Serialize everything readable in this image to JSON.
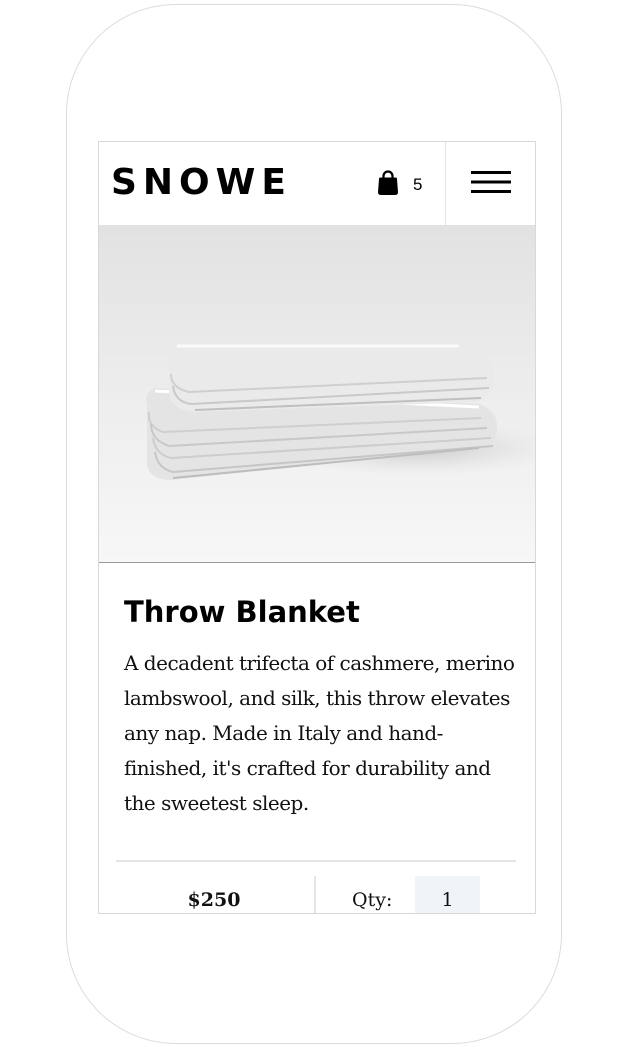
{
  "brand": {
    "logo_text": "SNOWE"
  },
  "header": {
    "cart_icon": "shopping-bag-icon",
    "cart_count": "5",
    "menu_icon": "hamburger-menu-icon"
  },
  "product": {
    "image_alt": "Stacked folded throw blankets",
    "title": "Throw Blanket",
    "description": "A decadent trifecta of cashmere, merino lambswool, and silk, this throw elevates any nap. Made in Italy and hand-finished, it's crafted for durability and the sweetest sleep.",
    "price": "$250",
    "quantity_label": "Qty:",
    "quantity_value": "1"
  },
  "colors": {
    "text": "#000000",
    "quantity_field_bg": "#f0f4f8",
    "border": "#e2e2e2"
  }
}
